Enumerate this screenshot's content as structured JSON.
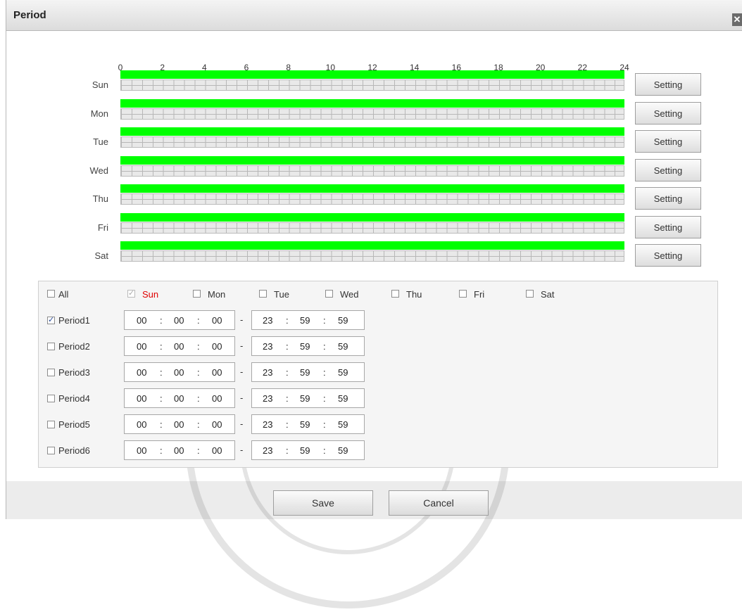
{
  "dialog": {
    "title": "Period",
    "close_icon": "close-icon"
  },
  "hours": [
    "0",
    "2",
    "4",
    "6",
    "8",
    "10",
    "12",
    "14",
    "16",
    "18",
    "20",
    "22",
    "24"
  ],
  "days": [
    {
      "label": "Sun",
      "active_range": [
        "00:00",
        "24:00"
      ]
    },
    {
      "label": "Mon",
      "active_range": [
        "00:00",
        "24:00"
      ]
    },
    {
      "label": "Tue",
      "active_range": [
        "00:00",
        "24:00"
      ]
    },
    {
      "label": "Wed",
      "active_range": [
        "00:00",
        "24:00"
      ]
    },
    {
      "label": "Thu",
      "active_range": [
        "00:00",
        "24:00"
      ]
    },
    {
      "label": "Fri",
      "active_range": [
        "00:00",
        "24:00"
      ]
    },
    {
      "label": "Sat",
      "active_range": [
        "00:00",
        "24:00"
      ]
    }
  ],
  "setting_label": "Setting",
  "day_select": {
    "all": {
      "label": "All",
      "checked": false
    },
    "days": [
      {
        "label": "Sun",
        "checked": true,
        "disabled": true,
        "highlight": true
      },
      {
        "label": "Mon",
        "checked": false
      },
      {
        "label": "Tue",
        "checked": false
      },
      {
        "label": "Wed",
        "checked": false
      },
      {
        "label": "Thu",
        "checked": false
      },
      {
        "label": "Fri",
        "checked": false
      },
      {
        "label": "Sat",
        "checked": false
      }
    ]
  },
  "periods": [
    {
      "label": "Period1",
      "checked": true,
      "start": [
        "00",
        "00",
        "00"
      ],
      "end": [
        "23",
        "59",
        "59"
      ]
    },
    {
      "label": "Period2",
      "checked": false,
      "start": [
        "00",
        "00",
        "00"
      ],
      "end": [
        "23",
        "59",
        "59"
      ]
    },
    {
      "label": "Period3",
      "checked": false,
      "start": [
        "00",
        "00",
        "00"
      ],
      "end": [
        "23",
        "59",
        "59"
      ]
    },
    {
      "label": "Period4",
      "checked": false,
      "start": [
        "00",
        "00",
        "00"
      ],
      "end": [
        "23",
        "59",
        "59"
      ]
    },
    {
      "label": "Period5",
      "checked": false,
      "start": [
        "00",
        "00",
        "00"
      ],
      "end": [
        "23",
        "59",
        "59"
      ]
    },
    {
      "label": "Period6",
      "checked": false,
      "start": [
        "00",
        "00",
        "00"
      ],
      "end": [
        "23",
        "59",
        "59"
      ]
    }
  ],
  "time_separator": ":",
  "range_separator": "-",
  "footer": {
    "save_label": "Save",
    "cancel_label": "Cancel"
  },
  "colors": {
    "active": "#00ff00",
    "highlight": "#e00000"
  }
}
